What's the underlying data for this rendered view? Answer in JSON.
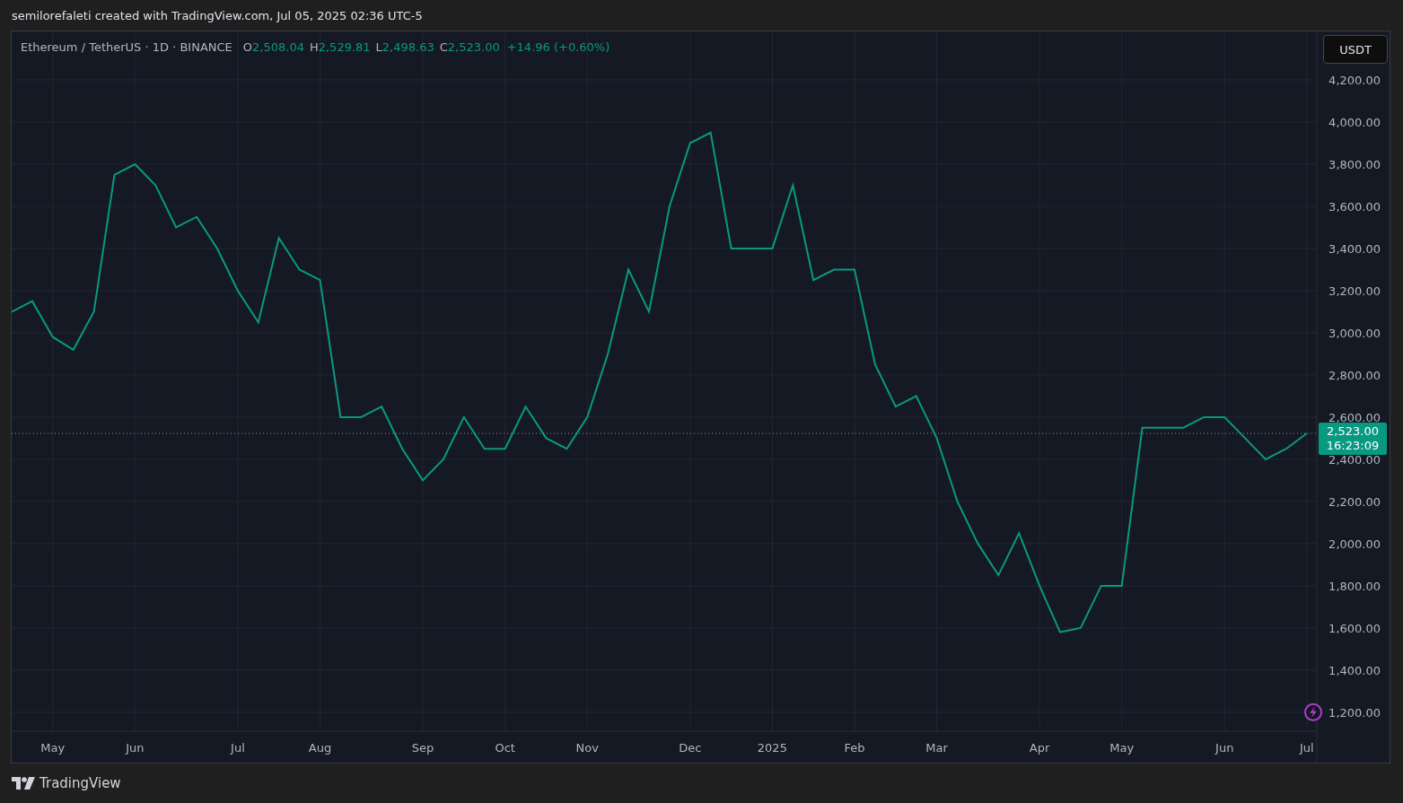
{
  "attribution": "semilorefaleti created with TradingView.com, Jul 05, 2025 02:36 UTC-5",
  "legend": {
    "symbol": "Ethereum / TetherUS · 1D · BINANCE",
    "fields": [
      {
        "label": "O",
        "value": "2,508.04"
      },
      {
        "label": "H",
        "value": "2,529.81"
      },
      {
        "label": "L",
        "value": "2,498.63"
      },
      {
        "label": "C",
        "value": "2,523.00"
      }
    ],
    "change": "+14.96 (+0.60%)"
  },
  "currency_button": "USDT",
  "price_tag": {
    "price": "2,523.00",
    "countdown": "16:23:09"
  },
  "chart_data": {
    "type": "line",
    "grid": true,
    "ref_lines": [
      {
        "axis": "y",
        "value": 2523
      }
    ],
    "ylim": [
      1110,
      4430
    ],
    "categories": [
      null,
      null,
      "May",
      null,
      null,
      null,
      "Jun",
      null,
      null,
      null,
      null,
      "Jul",
      null,
      null,
      null,
      "Aug",
      null,
      null,
      null,
      null,
      "Sep",
      null,
      null,
      null,
      "Oct",
      null,
      null,
      null,
      "Nov",
      null,
      null,
      null,
      null,
      "Dec",
      null,
      null,
      null,
      "2025",
      null,
      null,
      null,
      "Feb",
      null,
      null,
      null,
      "Mar",
      null,
      null,
      null,
      null,
      "Apr",
      null,
      null,
      null,
      "May",
      null,
      null,
      null,
      null,
      "Jun",
      null,
      null,
      null,
      "Jul"
    ],
    "series": [
      {
        "color": "#089981",
        "values": [
          3100,
          3150,
          2980,
          2920,
          3100,
          3750,
          3800,
          3700,
          3500,
          3550,
          3400,
          3200,
          3050,
          3450,
          3300,
          3250,
          2600,
          2600,
          2650,
          2450,
          2300,
          2400,
          2600,
          2450,
          2450,
          2650,
          2500,
          2450,
          2600,
          2900,
          3300,
          3100,
          3600,
          3900,
          3950,
          3400,
          3400,
          3400,
          3700,
          3250,
          3300,
          3300,
          2850,
          2650,
          2700,
          2500,
          2200,
          2000,
          1850,
          2050,
          1800,
          1580,
          1600,
          1800,
          1800,
          2550,
          2550,
          2550,
          2600,
          2600,
          2500,
          2400,
          2450,
          2523
        ]
      }
    ],
    "yticks": [
      {
        "value": 1200,
        "label": "1,200.00"
      },
      {
        "value": 1400,
        "label": "1,400.00"
      },
      {
        "value": 1600,
        "label": "1,600.00"
      },
      {
        "value": 1800,
        "label": "1,800.00"
      },
      {
        "value": 2000,
        "label": "2,000.00"
      },
      {
        "value": 2200,
        "label": "2,200.00"
      },
      {
        "value": 2400,
        "label": "2,400.00"
      },
      {
        "value": 2600,
        "label": "2,600.00"
      },
      {
        "value": 2800,
        "label": "2,800.00"
      },
      {
        "value": 3000,
        "label": "3,000.00"
      },
      {
        "value": 3200,
        "label": "3,200.00"
      },
      {
        "value": 3400,
        "label": "3,400.00"
      },
      {
        "value": 3600,
        "label": "3,600.00"
      },
      {
        "value": 3800,
        "label": "3,800.00"
      },
      {
        "value": 4000,
        "label": "4,000.00"
      },
      {
        "value": 4200,
        "label": "4,200.00"
      }
    ]
  },
  "brand": "TradingView"
}
